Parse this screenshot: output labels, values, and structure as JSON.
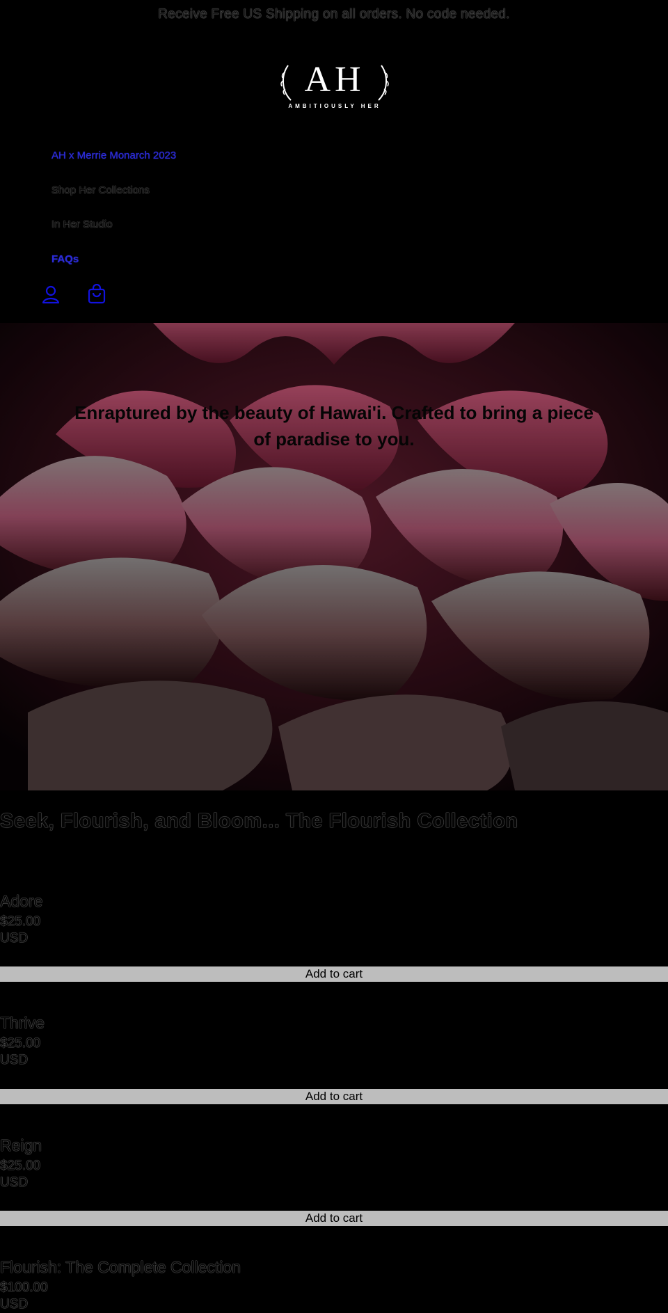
{
  "announcement": "Receive Free US Shipping on all orders. No code needed.",
  "logo": {
    "letters": "AH",
    "tagline": "AMBITIOUSLY HER"
  },
  "nav": {
    "items": [
      {
        "label": "AH x Merrie Monarch 2023"
      },
      {
        "label": "Shop Her Collections"
      },
      {
        "label": "In Her Studio"
      },
      {
        "label": "FAQs"
      }
    ]
  },
  "header_icons": {
    "account": "account-icon",
    "cart": "cart-icon"
  },
  "hero": {
    "text": "Enraptured by the beauty of Hawai'i. Crafted to bring a piece of paradise to you."
  },
  "collection": {
    "title": "Seek, Flourish, and Bloom... The Flourish Collection",
    "products": [
      {
        "name": "Adore",
        "price": "$25.00",
        "currency": "USD",
        "button": "Add to cart"
      },
      {
        "name": "Thrive",
        "price": "$25.00",
        "currency": "USD",
        "button": "Add to cart"
      },
      {
        "name": "Reign",
        "price": "$25.00",
        "currency": "USD",
        "button": "Add to cart"
      },
      {
        "name": "Flourish: The Complete Collection",
        "price": "$100.00",
        "currency": "USD"
      }
    ]
  },
  "colors": {
    "background": "#000000",
    "link_blue": "#2b2bd6",
    "button_gray": "#bdbdbd"
  }
}
